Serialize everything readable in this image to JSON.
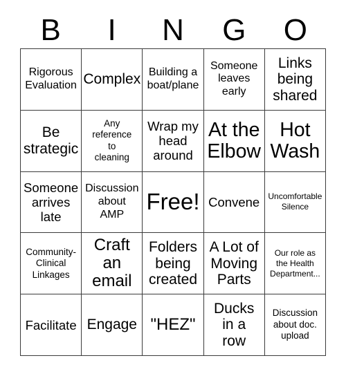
{
  "card": {
    "title_letters": [
      "B",
      "I",
      "N",
      "G",
      "O"
    ],
    "grid": {
      "rows": 5,
      "columns": 5,
      "border_color": "#3b3b3b",
      "background_color": "#ffffff",
      "text_color": "#000000"
    },
    "cells": [
      {
        "text": "Rigorous\nEvaluation",
        "size": "md",
        "column": "B",
        "row": 1
      },
      {
        "text": "Complex",
        "size": "xl",
        "column": "I",
        "row": 1
      },
      {
        "text": "Building a\nboat/plane",
        "size": "md",
        "column": "N",
        "row": 1
      },
      {
        "text": "Someone\nleaves\nearly",
        "size": "md",
        "column": "G",
        "row": 1
      },
      {
        "text": "Links\nbeing\nshared",
        "size": "xl",
        "column": "O",
        "row": 1
      },
      {
        "text": "Be\nstrategic",
        "size": "xl",
        "column": "B",
        "row": 2
      },
      {
        "text": "Any\nreference\nto\ncleaning",
        "size": "sm",
        "column": "I",
        "row": 2
      },
      {
        "text": "Wrap my\nhead\naround",
        "size": "lg",
        "column": "N",
        "row": 2
      },
      {
        "text": "At the\nElbow",
        "size": "3xl",
        "column": "G",
        "row": 2
      },
      {
        "text": "Hot\nWash",
        "size": "3xl",
        "column": "O",
        "row": 2
      },
      {
        "text": "Someone\narrives\nlate",
        "size": "lg",
        "column": "B",
        "row": 3
      },
      {
        "text": "Discussion\nabout\nAMP",
        "size": "md",
        "column": "I",
        "row": 3
      },
      {
        "text": "Free!",
        "size": "4xl",
        "column": "N",
        "row": 3
      },
      {
        "text": "Convene",
        "size": "lg",
        "column": "G",
        "row": 3
      },
      {
        "text": "Uncomfortable\nSilence",
        "size": "xs",
        "column": "O",
        "row": 3
      },
      {
        "text": "Community-\nClinical\nLinkages",
        "size": "sm",
        "column": "B",
        "row": 4
      },
      {
        "text": "Craft\nan\nemail",
        "size": "2xl",
        "column": "I",
        "row": 4
      },
      {
        "text": "Folders\nbeing\ncreated",
        "size": "xl",
        "column": "N",
        "row": 4
      },
      {
        "text": "A Lot of\nMoving\nParts",
        "size": "xl",
        "column": "G",
        "row": 4
      },
      {
        "text": "Our role as\nthe Health\nDepartment...",
        "size": "xs",
        "column": "O",
        "row": 4
      },
      {
        "text": "Facilitate",
        "size": "lg",
        "column": "B",
        "row": 5
      },
      {
        "text": "Engage",
        "size": "xl",
        "column": "I",
        "row": 5
      },
      {
        "text": "\"HEZ\"",
        "size": "2xl",
        "column": "N",
        "row": 5
      },
      {
        "text": "Ducks\nin a\nrow",
        "size": "xl",
        "column": "G",
        "row": 5
      },
      {
        "text": "Discussion\nabout doc.\nupload",
        "size": "sm",
        "column": "O",
        "row": 5
      }
    ]
  }
}
